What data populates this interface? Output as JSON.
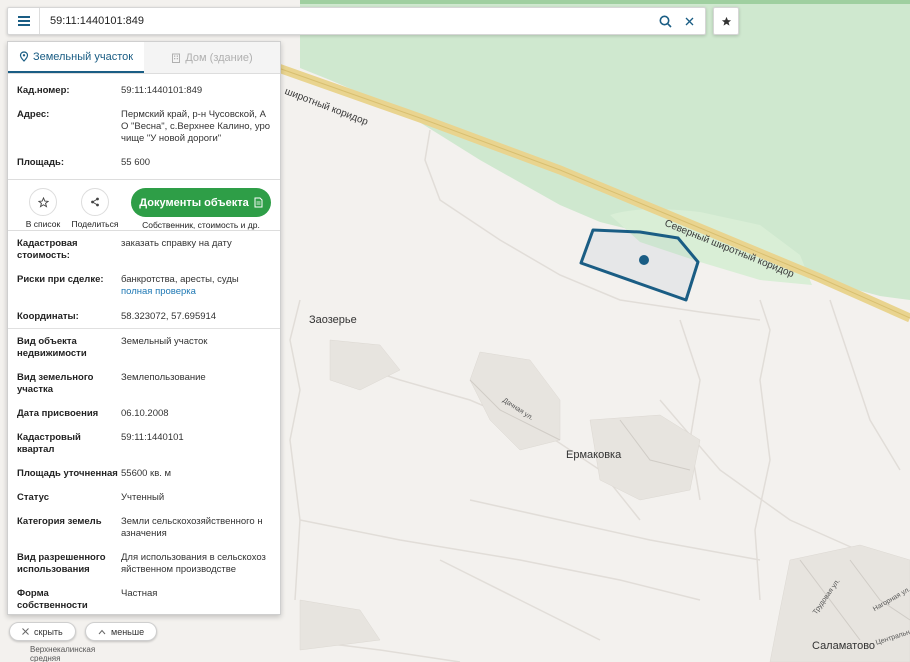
{
  "search": {
    "value": "59:11:1440101:849"
  },
  "tabs": [
    {
      "label": "Земельный участок",
      "active": true
    },
    {
      "label": "Дом (здание)",
      "active": false
    }
  ],
  "basic": [
    {
      "key": "Кад.номер:",
      "value": "59:11:1440101:849",
      "link": true
    },
    {
      "key": "Адрес:",
      "value": "Пермский край, р-н Чусовской, АО \"Весна\", с.Верхнее Калино, урочище \"У новой дороги\"",
      "link": false
    },
    {
      "key": "Площадь:",
      "value": "55 600",
      "link": false
    }
  ],
  "address_lines": [
    "Пермский край, р-н Чусовской, А",
    "О \"Весна\", с.Верхнее Калино, уро",
    "чище \"У новой дороги\""
  ],
  "actions": {
    "favorite": "В список",
    "share": "Поделиться",
    "docs_button": "Документы объекта",
    "docs_caption": "Собственник, стоимость и др."
  },
  "cadastral_value": {
    "key_line1": "Кадастровая",
    "key_line2": "стоимость:",
    "value": "заказать справку на дату"
  },
  "risks": {
    "key": "Риски при сделке:",
    "value": "банкротства, аресты, суды",
    "link": "полная проверка"
  },
  "coords": {
    "key": "Координаты:",
    "value": "58.323072, 57.695914"
  },
  "details": [
    {
      "key1": "Вид объекта",
      "key2": "недвижимости",
      "v1": "Земельный участок",
      "v2": ""
    },
    {
      "key1": "Вид земельного",
      "key2": "участка",
      "v1": "Землепользование",
      "v2": ""
    },
    {
      "key1": "Дата присвоения",
      "key2": "",
      "v1": "06.10.2008",
      "v2": ""
    },
    {
      "key1": "Кадастровый",
      "key2": "квартал",
      "v1": "59:11:1440101",
      "v2": ""
    },
    {
      "key1": "Площадь уточненная",
      "key2": "",
      "v1": "55600 кв. м",
      "v2": ""
    },
    {
      "key1": "Статус",
      "key2": "",
      "v1": "Учтенный",
      "v2": ""
    },
    {
      "key1": "Категория земель",
      "key2": "",
      "v1": "Земли сельскохозяйственного н",
      "v2": "азначения"
    },
    {
      "key1": "Вид разрешенного",
      "key2": "использования",
      "v1": "Для использования в сельскохоз",
      "v2": "яйственном производстве"
    },
    {
      "key1": "Форма",
      "key2": "собственности",
      "v1": "Частная",
      "v2": ""
    }
  ],
  "bottom": {
    "hide": "скрыть",
    "less": "меньше"
  },
  "map_labels": {
    "road_top": "широтный коридор",
    "road_right": "Северный широтный коридор",
    "zaozerye": "Заозерье",
    "ermakovka": "Ермаковка",
    "dachnaya": "Дачная ул.",
    "salamatovo": "Саламатово",
    "trudovaya": "Трудовая ул.",
    "nagornaya": "Нагорная ул.",
    "centralnaya": "Центральн",
    "verkhnekalinskaya_1": "Верхнекалинская",
    "verkhnekalinskaya_2": "средняя"
  },
  "colors": {
    "parcel": "#1a5d84",
    "forest": "#cfe8cf",
    "road": "#e8d28a",
    "accent": "#2e9e47"
  }
}
